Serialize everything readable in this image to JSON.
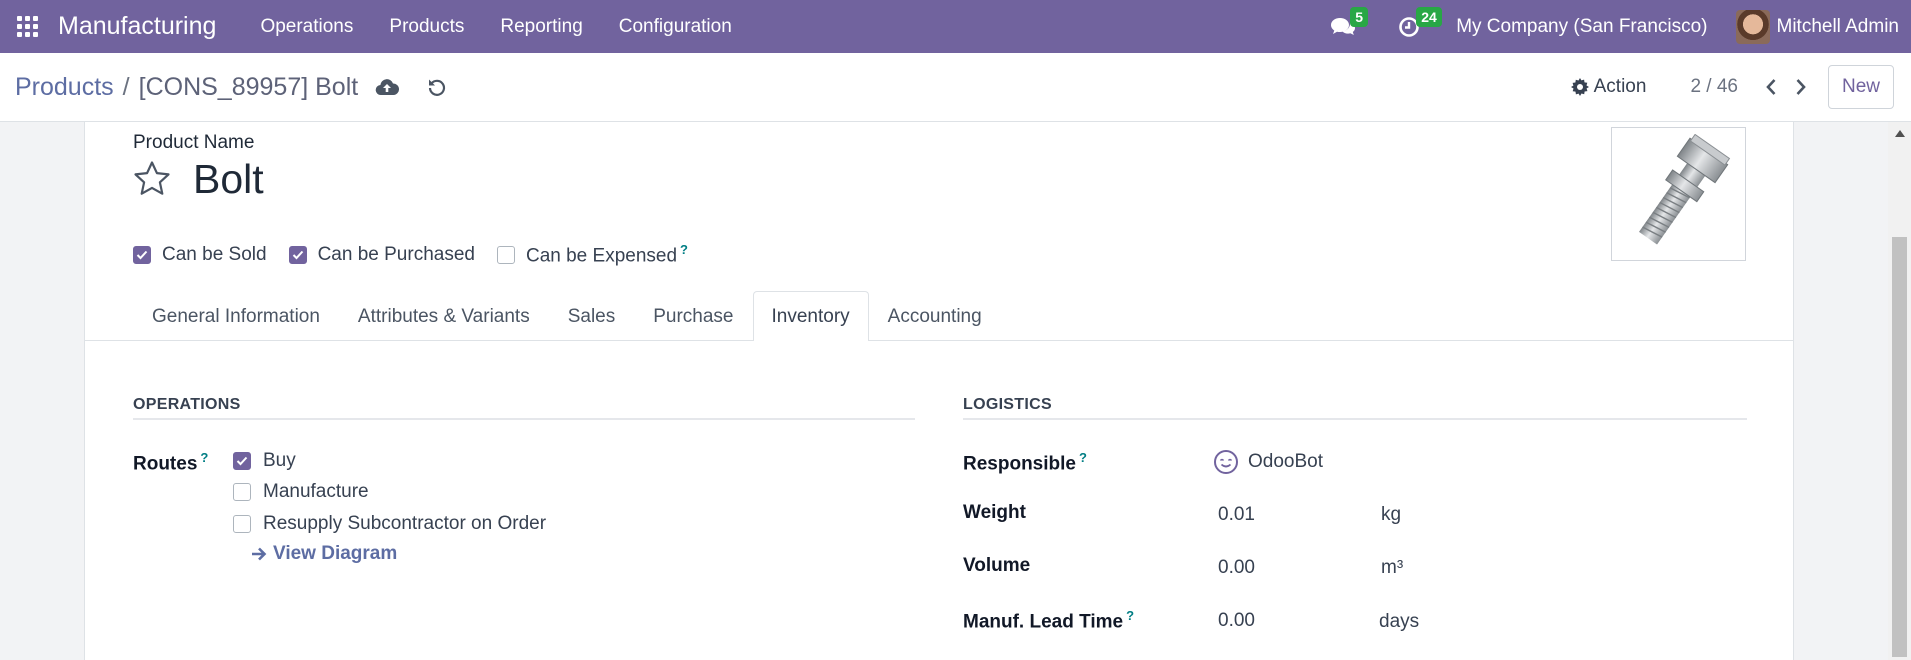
{
  "navbar": {
    "app_name": "Manufacturing",
    "menu": [
      "Operations",
      "Products",
      "Reporting",
      "Configuration"
    ],
    "messages_count": "5",
    "activities_count": "24",
    "company": "My Company (San Francisco)",
    "user": "Mitchell Admin",
    "color": "#71639e"
  },
  "control": {
    "breadcrumb_parent": "Products",
    "breadcrumb_sep": "/",
    "breadcrumb_current": "[CONS_89957] Bolt",
    "action_label": "Action",
    "pager": "2 / 46",
    "new_label": "New"
  },
  "product": {
    "name_label": "Product Name",
    "name": "Bolt",
    "can_be_sold": {
      "label": "Can be Sold",
      "checked": true
    },
    "can_be_purchased": {
      "label": "Can be Purchased",
      "checked": true
    },
    "can_be_expensed": {
      "label": "Can be Expensed",
      "checked": false,
      "help": "?"
    }
  },
  "tabs": [
    "General Information",
    "Attributes & Variants",
    "Sales",
    "Purchase",
    "Inventory",
    "Accounting"
  ],
  "active_tab": "Inventory",
  "operations": {
    "title": "OPERATIONS",
    "routes_label": "Routes",
    "routes_help": "?",
    "routes": [
      {
        "label": "Buy",
        "checked": true
      },
      {
        "label": "Manufacture",
        "checked": false
      },
      {
        "label": "Resupply Subcontractor on Order",
        "checked": false
      }
    ],
    "view_diagram": "View Diagram"
  },
  "logistics": {
    "title": "LOGISTICS",
    "responsible_label": "Responsible",
    "responsible_help": "?",
    "responsible": "OdooBot",
    "weight_label": "Weight",
    "weight": "0.01",
    "weight_unit": "kg",
    "volume_label": "Volume",
    "volume": "0.00",
    "volume_unit": "m³",
    "lead_time_label": "Manuf. Lead Time",
    "lead_time_help": "?",
    "lead_time": "0.00",
    "lead_time_unit": "days"
  }
}
